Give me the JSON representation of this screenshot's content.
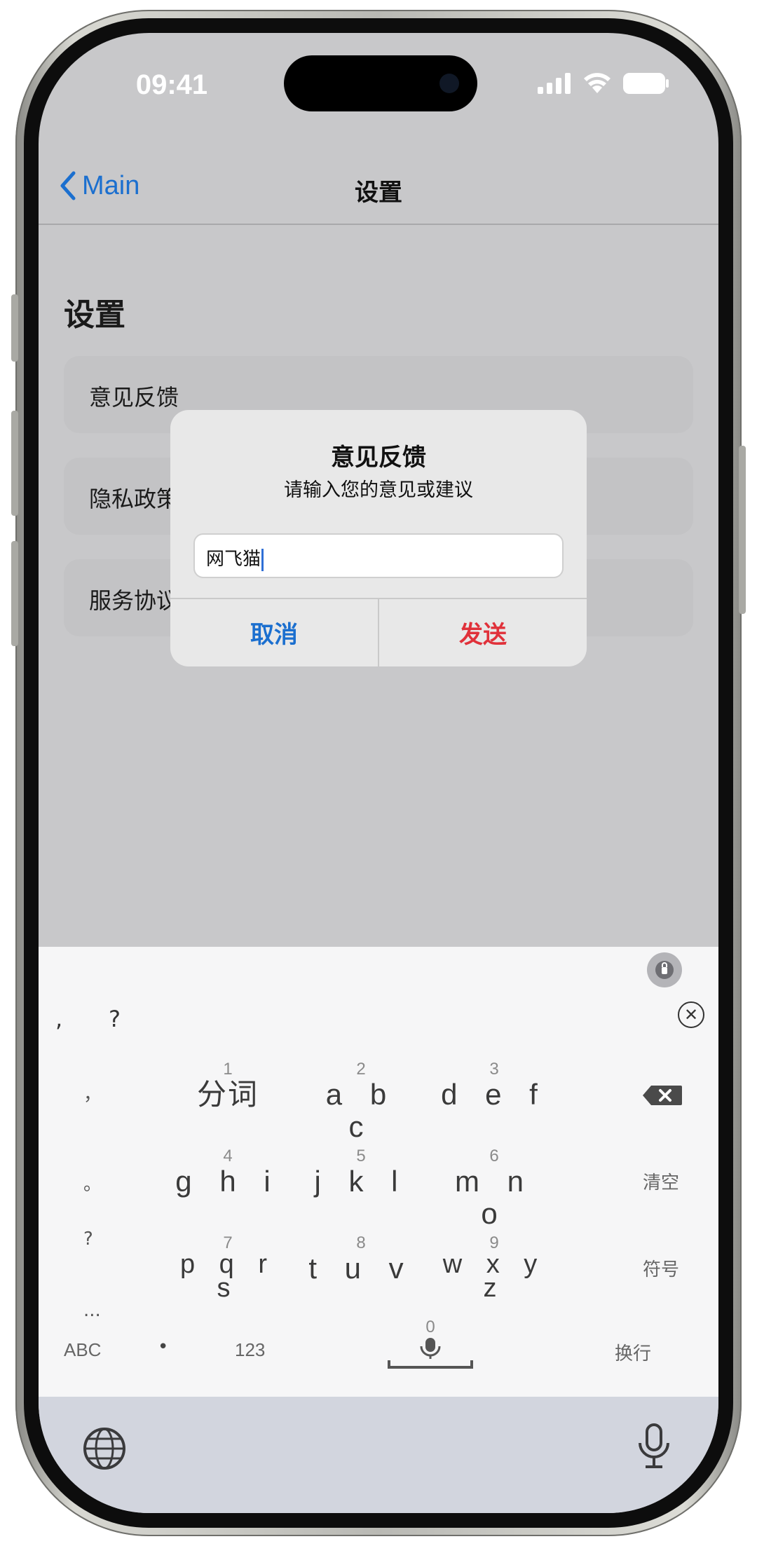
{
  "status": {
    "time": "09:41"
  },
  "nav": {
    "back_label": "Main",
    "title": "设置"
  },
  "section": {
    "title": "设置"
  },
  "rows": [
    {
      "label": "意见反馈"
    },
    {
      "label": "隐私政策"
    },
    {
      "label": "服务协议"
    }
  ],
  "dialog": {
    "title": "意见反馈",
    "message": "请输入您的意见或建议",
    "input_value": "网飞猫",
    "cancel_label": "取消",
    "send_label": "发送"
  },
  "keyboard": {
    "candidates": [
      ",",
      "?"
    ],
    "keys": [
      {
        "num": "1",
        "letters": "分词"
      },
      {
        "num": "2",
        "letters": "a b c"
      },
      {
        "num": "3",
        "letters": "d e f"
      },
      {
        "num": "4",
        "letters": "g h i"
      },
      {
        "num": "5",
        "letters": "j k l"
      },
      {
        "num": "6",
        "letters": "m n o"
      },
      {
        "num": "7",
        "letters": "p q r",
        "letters2": "s"
      },
      {
        "num": "8",
        "letters": "t u v"
      },
      {
        "num": "9",
        "letters": "w x y",
        "letters2": "z"
      }
    ],
    "punctuation": [
      "，",
      "。",
      "?",
      "..."
    ],
    "clear_label": "清空",
    "symbols_label": "符号",
    "abc_label": "ABC",
    "dot_label": "•",
    "num_label": "123",
    "space_num": "0",
    "return_label": "换行"
  },
  "colors": {
    "accent_blue": "#1b6fcf",
    "send_red": "#e0313a"
  }
}
